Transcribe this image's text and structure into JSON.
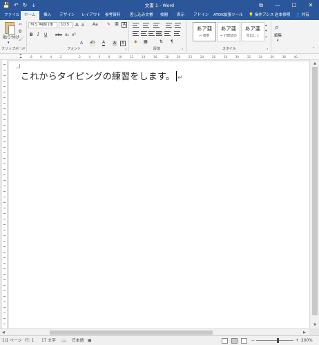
{
  "titlebar": {
    "title": "文書 1 - Word",
    "quick_access": {
      "save_icon": "💾",
      "undo_icon": "↶",
      "redo_icon": "↻",
      "customize_icon": "⇣"
    },
    "window_buttons": {
      "ribbon_display": "⧉",
      "minimize": "—",
      "maximize": "☐",
      "close": "✕"
    }
  },
  "tabs": {
    "file": "ファイル",
    "home": "ホーム",
    "insert": "挿入",
    "design": "デザイン",
    "layout": "レイアウト",
    "references": "参考資料",
    "mailings": "差し込み文書",
    "review": "校閲",
    "view": "表示",
    "addins": "アドイン",
    "atok": "ATOK拡張ツール",
    "tell_me": "操作アシス",
    "user": "岩本修明",
    "share": "共有"
  },
  "ribbon": {
    "clipboard": {
      "paste_label": "貼り付け",
      "group_label": "クリップボード"
    },
    "font": {
      "font_name": "ＭＳ 明朝 (本",
      "font_size": "10.5",
      "grow": "A",
      "shrink": "A",
      "case": "Aa",
      "clear": "✎",
      "bold": "B",
      "italic": "I",
      "underline": "U",
      "strike": "abc",
      "subscript": "x₂",
      "superscript": "x²",
      "effects": "A",
      "highlight": "ab",
      "color": "A",
      "charshade": "A",
      "charborder": "A",
      "group_label": "フォント"
    },
    "paragraph": {
      "group_label": "段落"
    },
    "styles": {
      "items": [
        {
          "sample": "あア亜",
          "name": "↵ 標準"
        },
        {
          "sample": "あア亜",
          "name": "↵ 行間詰め"
        },
        {
          "sample": "あア亜",
          "name": "見出し 1"
        }
      ],
      "group_label": "スタイル"
    },
    "editing": {
      "label": "編集"
    }
  },
  "ruler": {
    "marks": [
      "8",
      "6",
      "4",
      "2",
      "",
      "2",
      "4",
      "6",
      "8",
      "10",
      "12",
      "14",
      "16",
      "18",
      "20",
      "22",
      "24",
      "26",
      "28",
      "30",
      "32",
      "34",
      "36",
      "38",
      "40"
    ]
  },
  "document": {
    "text": "これからタイピングの練習をします。",
    "paragraph_mark": "↵"
  },
  "status": {
    "page": "1/1 ページ",
    "line": "行: 1",
    "chars": "17 文字",
    "language": "日本語",
    "zoom": "200%",
    "zoom_minus": "−",
    "zoom_plus": "+"
  },
  "colors": {
    "accent": "#2b579a",
    "ribbon_bg": "#f3f3f3",
    "canvas_bg": "#e6e6e6",
    "highlight_yellow": "#ffff00",
    "font_red": "#e81123"
  }
}
